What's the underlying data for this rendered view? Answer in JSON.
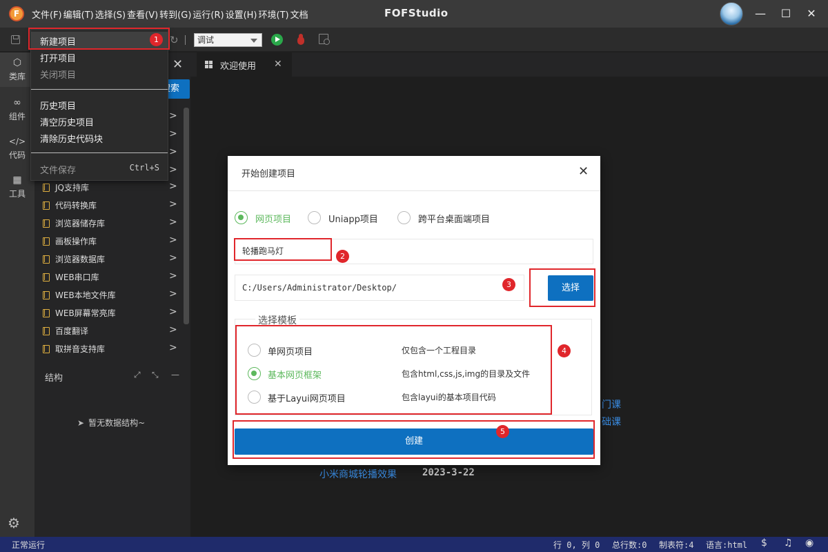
{
  "app": {
    "logo": "F",
    "title": "FOFStudio"
  },
  "menubar": [
    "文件(F)",
    "编辑(T)",
    "选择(S)",
    "查看(V)",
    "转到(G)",
    "运行(R)",
    "设置(H)",
    "环境(T)",
    "文档"
  ],
  "window_controls": {
    "minimize": "—",
    "maximize": "☐",
    "close": "✕"
  },
  "toolbar": {
    "run_mode": "调试"
  },
  "activity_bar": [
    {
      "icon": "cube-icon",
      "label": "类库"
    },
    {
      "icon": "infinity-icon",
      "label": "组件"
    },
    {
      "icon": "code-icon",
      "label": "代码"
    },
    {
      "icon": "tools-icon",
      "label": "工具"
    }
  ],
  "sidebar": {
    "search_button": "搜索",
    "library_items": [
      "JQ支持库",
      "代码转换库",
      "浏览器储存库",
      "画板操作库",
      "浏览器数据库",
      "WEB串口库",
      "WEB本地文件库",
      "WEB屏幕常亮库",
      "百度翻译",
      "取拼音支持库"
    ],
    "structure_title": "结构",
    "no_structure": "暂无数据结构~"
  },
  "editor": {
    "tab_label": "欢迎使用",
    "links": [
      "门课",
      "础课",
      "小米商城轮播效果"
    ],
    "date": "2023-3-22"
  },
  "file_menu": {
    "items": [
      {
        "label": "新建项目",
        "disabled": false
      },
      {
        "label": "打开项目",
        "disabled": false
      },
      {
        "label": "关闭项目",
        "disabled": true
      },
      {
        "label": "历史项目",
        "disabled": false
      },
      {
        "label": "清空历史项目",
        "disabled": false
      },
      {
        "label": "清除历史代码块",
        "disabled": false
      },
      {
        "label": "文件保存",
        "shortcut": "Ctrl+S",
        "disabled": true
      }
    ]
  },
  "dialog": {
    "title": "开始创建项目",
    "project_types": [
      {
        "label": "网页项目",
        "selected": true
      },
      {
        "label": "Uniapp项目",
        "selected": false
      },
      {
        "label": "跨平台桌面端项目",
        "selected": false
      }
    ],
    "project_name": "轮播跑马灯",
    "path": "C:/Users/Administrator/Desktop/",
    "choose_button": "选择",
    "template_legend": "选择模板",
    "templates": [
      {
        "label": "单网页项目",
        "description": "仅包含一个工程目录",
        "selected": false
      },
      {
        "label": "基本网页框架",
        "description": "包含html,css,js,img的目录及文件",
        "selected": true
      },
      {
        "label": "基于Layui网页项目",
        "description": "包含layui的基本项目代码",
        "selected": false
      }
    ],
    "create_button": "创建"
  },
  "annotations": [
    "1",
    "2",
    "3",
    "4",
    "5"
  ],
  "statusbar": {
    "left": "正常运行",
    "position": "行 0, 列 0",
    "total_lines": "总行数:0",
    "tab_size": "制表符:4",
    "language": "语言:html"
  },
  "colors": {
    "accent_blue": "#0e70c0",
    "selected_green": "#5cb85c",
    "annotation_red": "#e0262b",
    "statusbar": "#1f2b6b"
  }
}
